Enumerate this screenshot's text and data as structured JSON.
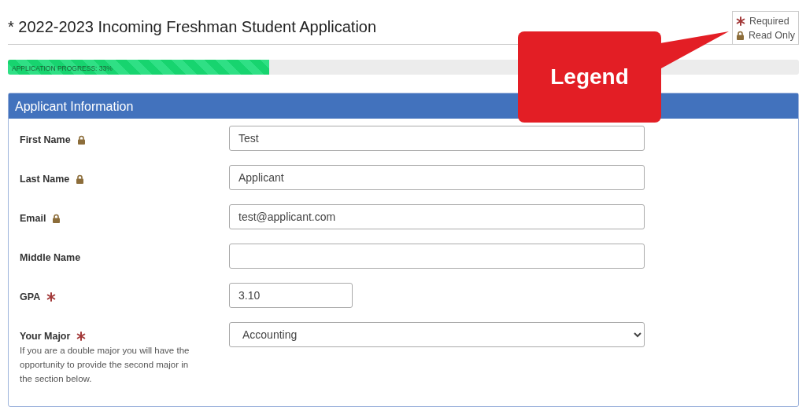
{
  "page_title": "* 2022-2023 Incoming Freshman Student Application",
  "legend": [
    {
      "kind": "required",
      "label": "Required"
    },
    {
      "kind": "readonly",
      "label": "Read Only"
    }
  ],
  "progress": {
    "label": "APPLICATION PROGRESS: 33%",
    "level": 0.33
  },
  "callout": {
    "label": "Legend"
  },
  "panel": {
    "title": "Applicant Information",
    "fields": [
      {
        "label": "First Name",
        "read_only": true,
        "required": false,
        "kind": "text",
        "value": "Test"
      },
      {
        "label": "Last Name",
        "read_only": true,
        "required": false,
        "kind": "text",
        "value": "Applicant"
      },
      {
        "label": "Email",
        "read_only": true,
        "required": false,
        "kind": "text",
        "value": "test@applicant.com"
      },
      {
        "label": "Middle Name",
        "read_only": false,
        "required": false,
        "kind": "text"
      },
      {
        "label": "GPA",
        "read_only": false,
        "required": true,
        "kind": "short",
        "value": "3.10"
      },
      {
        "label": "Your Major",
        "read_only": false,
        "required": true,
        "kind": "select",
        "value": "Accounting",
        "help": "If you are a double major you will have the opportunity to provide the second major in the section below."
      }
    ]
  }
}
